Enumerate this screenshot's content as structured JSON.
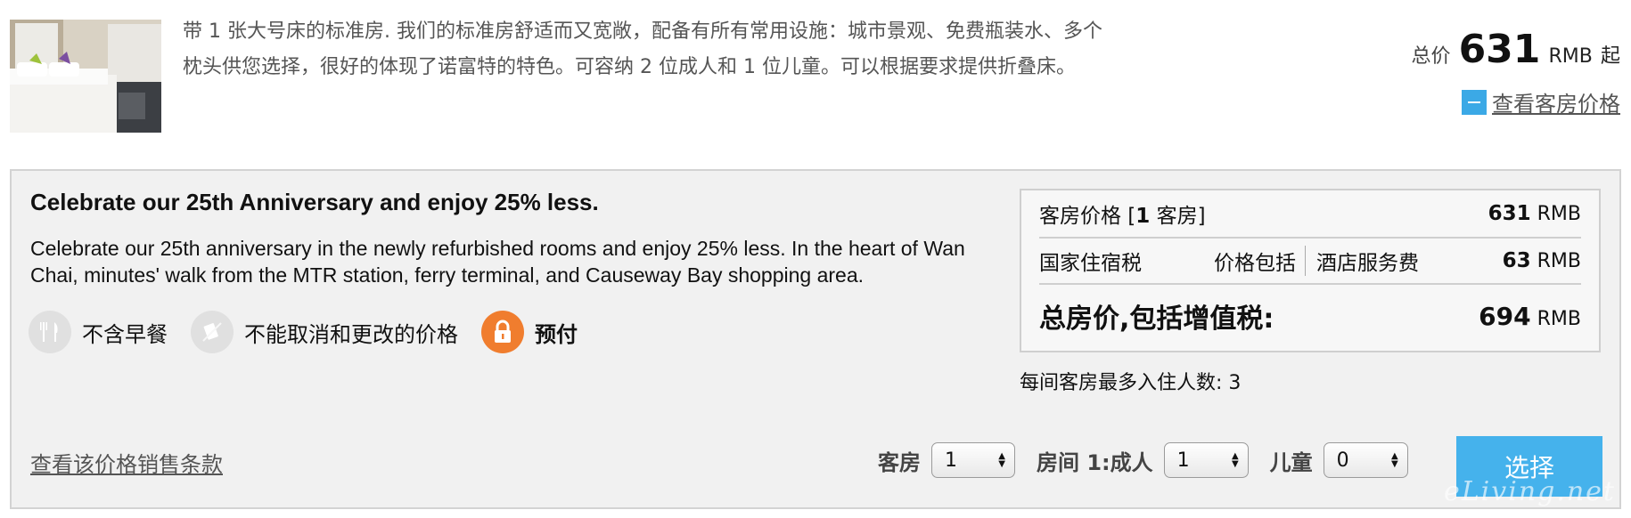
{
  "room": {
    "image_alt": "standard room with king bed",
    "description": "带 1 张大号床的标准房. 我们的标准房舒适而又宽敞，配备有所有常用设施：城市景观、免费瓶装水、多个枕头供您选择，很好的体现了诺富特的特色。可容纳 2 位成人和 1 位儿童。可以根据要求提供折叠床。",
    "price_prefix": "总价",
    "price_amount": "631",
    "price_currency": "RMB",
    "price_suffix": "起",
    "rates_link": "查看客房价格",
    "rates_icon": "minus-icon"
  },
  "offer": {
    "title": "Celebrate our 25th Anniversary and enjoy 25% less.",
    "description": "Celebrate our 25th anniversary in the newly refurbished rooms and enjoy 25% less. In the heart of Wan Chai, minutes' walk from the MTR station, ferry terminal, and Causeway Bay shopping area.",
    "features": [
      {
        "icon": "cutlery-icon",
        "label": "不含早餐"
      },
      {
        "icon": "no-cancel-icon",
        "label": "不能取消和更改的价格"
      },
      {
        "icon": "padlock-icon",
        "label": "预付"
      }
    ],
    "terms_link": "查看该价格销售条款"
  },
  "summary": {
    "room_price_label": "客房价格 [",
    "room_count": "1",
    "room_price_label_end": " 客房]",
    "room_price_value": "631",
    "currency": "RMB",
    "tax_label": "国家住宿税",
    "tax_included": "价格包括",
    "service_label": "酒店服务费",
    "service_value": "63",
    "total_label": "总房价,包括增值税:",
    "total_value": "694",
    "max_occupancy": "每间客房最多入住人数: 3"
  },
  "controls": {
    "rooms_label": "客房",
    "rooms_value": "1",
    "adults_label": "房间 1:成人",
    "adults_value": "1",
    "children_label": "儿童",
    "children_value": "0",
    "select_button": "选择"
  },
  "watermark": "eLiving.net",
  "colors": {
    "accent_blue": "#45b2ec",
    "prepay_orange": "#f07d2e",
    "panel_bg": "#f1f1f1"
  }
}
